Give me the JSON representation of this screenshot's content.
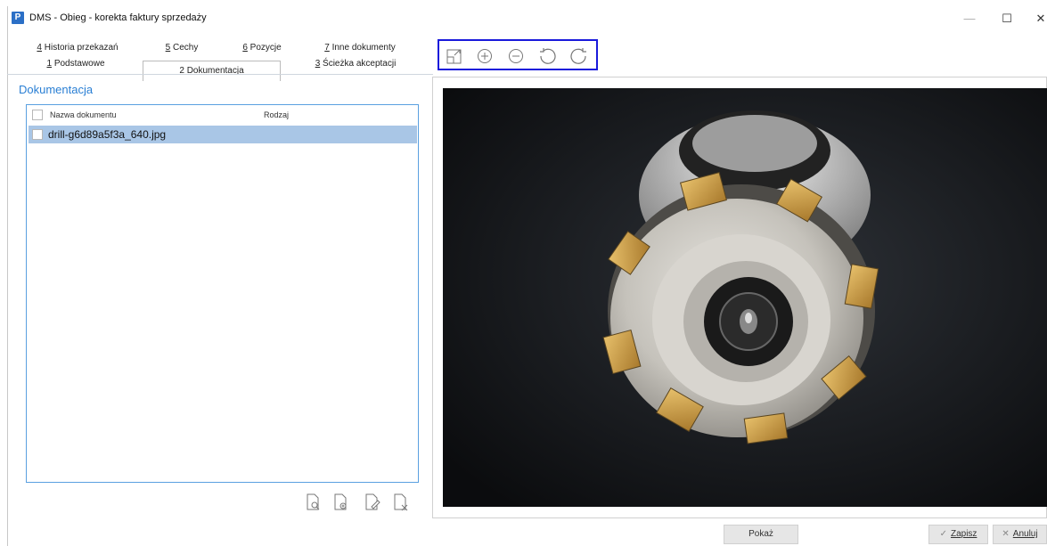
{
  "window": {
    "title": "DMS - Obieg - korekta faktury sprzedaży",
    "app_icon_letter": "P",
    "minimize_glyph": "—",
    "maximize_glyph": "☐",
    "close_glyph": "✕"
  },
  "tabs": {
    "row1": [
      {
        "key": "4",
        "label": "Historia przekazań"
      },
      {
        "key": "5",
        "label": "Cechy"
      },
      {
        "key": "6",
        "label": "Pozycje"
      },
      {
        "key": "7",
        "label": "Inne dokumenty"
      }
    ],
    "row2": [
      {
        "key": "1",
        "label": "Podstawowe"
      },
      {
        "key": "2",
        "label": "Dokumentacja",
        "active": true
      },
      {
        "key": "3",
        "label": "Ścieżka akceptacji"
      }
    ]
  },
  "documentation": {
    "section_title": "Dokumentacja",
    "columns": [
      "Nazwa dokumentu",
      "Rodzaj"
    ],
    "rows": [
      {
        "name": "drill-g6d89a5f3a_640.jpg",
        "type": "",
        "selected": true
      }
    ],
    "actions": [
      {
        "icon": "preview-document-icon"
      },
      {
        "icon": "add-document-icon"
      },
      {
        "icon": "edit-document-icon"
      },
      {
        "icon": "delete-document-icon"
      }
    ]
  },
  "viewer": {
    "toolbar": [
      {
        "icon": "fit-to-window-icon"
      },
      {
        "icon": "zoom-in-icon"
      },
      {
        "icon": "zoom-out-icon"
      },
      {
        "icon": "rotate-left-icon"
      },
      {
        "icon": "rotate-right-icon"
      }
    ],
    "toolbar_border_color": "#1a1adb"
  },
  "buttons": {
    "show_label": "Pokaż",
    "save_label": "Zapisz",
    "cancel_label": "Anuluj"
  },
  "colors": {
    "accent": "#2a7fd4",
    "selection": "#a9c6e6",
    "list_border": "#5aa0e0"
  }
}
